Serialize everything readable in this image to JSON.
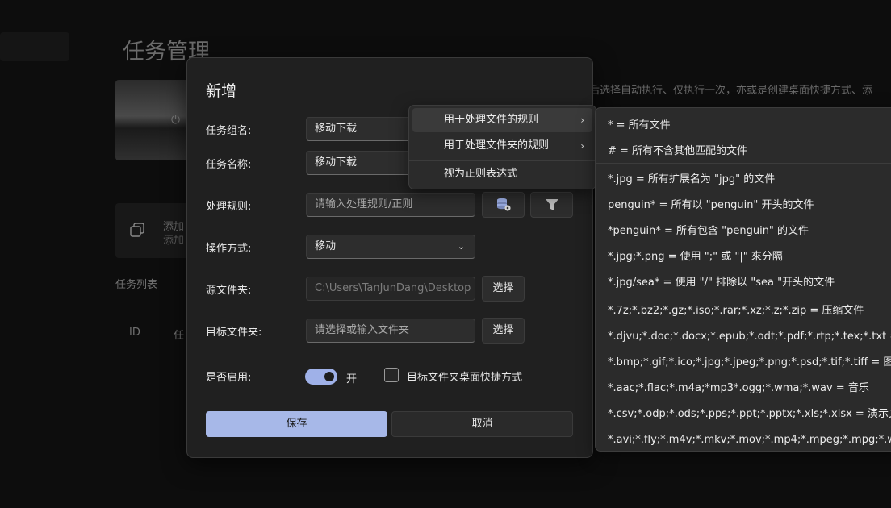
{
  "background": {
    "page_title": "任务管理",
    "description": "后选择自动执行、仅执行一次，亦或是创建桌面快捷方式、添",
    "card_line1": "添加",
    "card_line2": "添加",
    "list_title": "任务列表",
    "col_id": "ID",
    "col_2": "任"
  },
  "dialog": {
    "title": "新增",
    "group_label": "任务组名:",
    "group_value": "移动下载",
    "name_label": "任务名称:",
    "name_value": "移动下载",
    "rule_label": "处理规则:",
    "rule_placeholder": "请输入处理规则/正则",
    "op_label": "操作方式:",
    "op_value": "移动",
    "src_label": "源文件夹:",
    "src_value": "C:\\Users\\TanJunDang\\Desktop",
    "src_button": "选择",
    "dst_label": "目标文件夹:",
    "dst_placeholder": "请选择或输入文件夹",
    "dst_button": "选择",
    "enable_label": "是否启用:",
    "toggle_text": "开",
    "shortcut_label": "目标文件夹桌面快捷方式",
    "save": "保存",
    "cancel": "取消"
  },
  "menu": {
    "items": [
      "用于处理文件的规则",
      "用于处理文件夹的规则",
      "视为正则表达式"
    ]
  },
  "submenu": {
    "items": [
      "* = 所有文件",
      "# = 所有不含其他匹配的文件",
      "*.jpg = 所有扩展名为 \"jpg\" 的文件",
      "penguin* = 所有以 \"penguin\" 开头的文件",
      "*penguin* = 所有包含 \"penguin\" 的文件",
      "*.jpg;*.png = 使用 \";\" 或 \"|\" 來分隔",
      "*.jpg/sea* = 使用 \"/\" 排除以 \"sea \"开头的文件",
      "*.7z;*.bz2;*.gz;*.iso;*.rar;*.xz;*.z;*.zip = 压缩文件",
      "*.djvu;*.doc;*.docx;*.epub;*.odt;*.pdf;*.rtp;*.tex;*.txt = 文档",
      "*.bmp;*.gif;*.ico;*.jpg;*.jpeg;*.png;*.psd;*.tif;*.tiff = 图片",
      "*.aac;*.flac;*.m4a;*mp3*.ogg;*.wma;*.wav = 音乐",
      "*.csv;*.odp;*.ods;*.pps;*.ppt;*.pptx;*.xls;*.xlsx = 演示文稿和",
      "*.avi;*.fly;*.m4v;*.mkv;*.mov;*.mp4;*.mpeg;*.mpg;*.wmv = 视"
    ]
  },
  "colors": {
    "accent": "#a7b8e8",
    "background": "#0d0d0d",
    "dialog": "#202020",
    "menu": "#2b2b2b"
  }
}
